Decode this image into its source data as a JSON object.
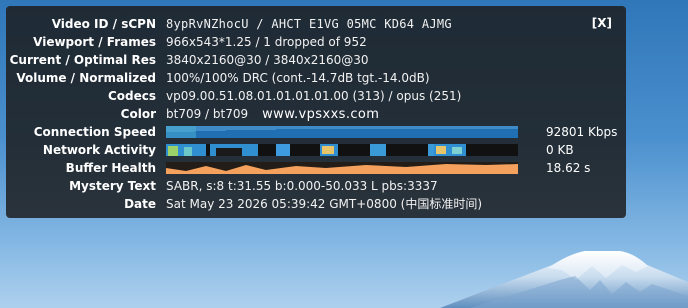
{
  "close_label": "[X]",
  "stats": {
    "video_id": {
      "label": "Video ID / sCPN",
      "value": "8ypRvNZhocU / AHCT E1VG 05MC KD64 AJMG"
    },
    "viewport": {
      "label": "Viewport / Frames",
      "value": "966x543*1.25 / 1 dropped of 952"
    },
    "resolution": {
      "label": "Current / Optimal Res",
      "value": "3840x2160@30 / 3840x2160@30"
    },
    "volume": {
      "label": "Volume / Normalized",
      "value": "100%/100% DRC (cont.-14.7dB tgt.-14.0dB)"
    },
    "codecs": {
      "label": "Codecs",
      "value": "vp09.00.51.08.01.01.01.01.00 (313) / opus (251)"
    },
    "color": {
      "label": "Color",
      "value": "bt709 / bt709",
      "watermark": "www.vpsxxs.com"
    },
    "connection_speed": {
      "label": "Connection Speed",
      "value": "92801 Kbps",
      "fraction": 0.95
    },
    "network_activity": {
      "label": "Network Activity",
      "value": "0 KB"
    },
    "buffer_health": {
      "label": "Buffer Health",
      "value": "18.62 s",
      "fraction": 0.8
    },
    "mystery_text": {
      "label": "Mystery Text",
      "value": "SABR, s:8 t:31.55 b:0.000-50.033 L pbs:3337"
    },
    "date": {
      "label": "Date",
      "value": "Sat May 23 2026 05:39:42 GMT+0800 (中国标准时间)"
    }
  },
  "colors": {
    "panel_background": "#1c1c1c",
    "connection_graph": "#1f6fb2",
    "connection_trace": "#4a9fdc",
    "buffer_graph": "#f4a15d",
    "network_graph_fill": "#2f8fd0"
  }
}
